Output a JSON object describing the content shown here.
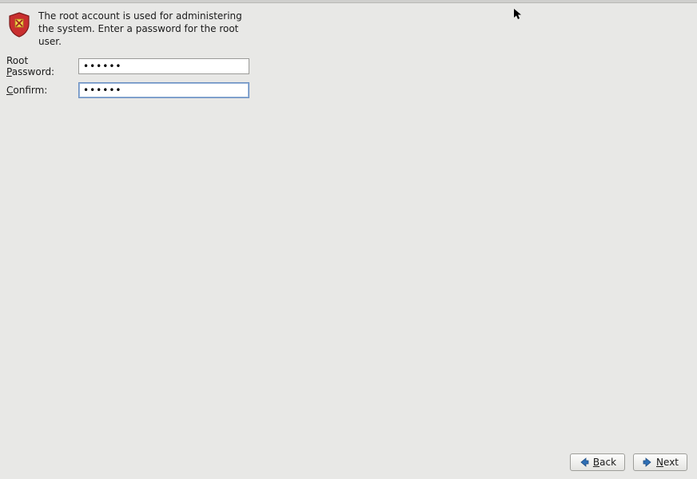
{
  "description": "The root account is used for administering the system.  Enter a password for the root user.",
  "labels": {
    "root_password_prefix": "Root ",
    "root_password_ul": "P",
    "root_password_suffix": "assword:",
    "confirm_ul": "C",
    "confirm_suffix": "onfirm:"
  },
  "values": {
    "root_password": "••••••",
    "confirm": "••••••"
  },
  "buttons": {
    "back_ul": "B",
    "back_suffix": "ack",
    "next_ul": "N",
    "next_suffix": "ext"
  },
  "icons": {
    "shield": "shield-icon",
    "arrow_left": "arrow-left-icon",
    "arrow_right": "arrow-right-icon"
  }
}
